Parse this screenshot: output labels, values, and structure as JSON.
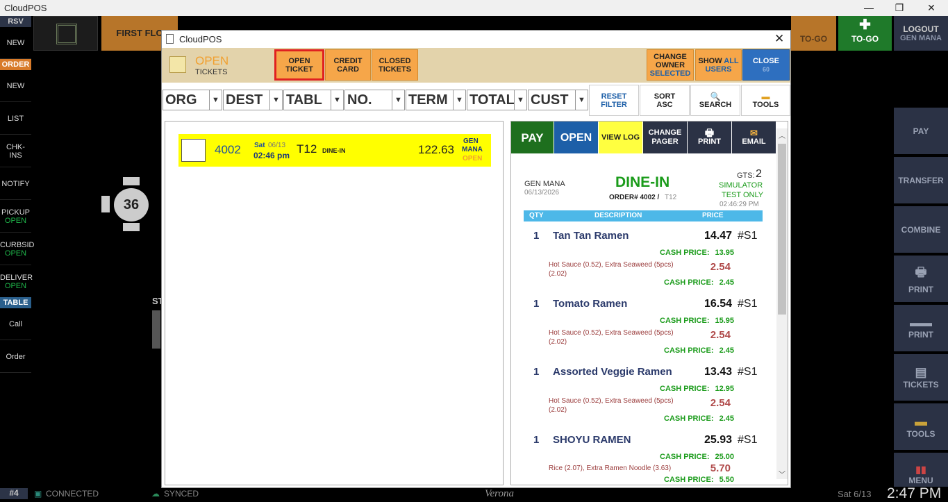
{
  "window": {
    "title": "CloudPOS",
    "min": "—",
    "restore": "❐",
    "close": "✕"
  },
  "leftbar": {
    "rsv": "RSV",
    "new1": "NEW",
    "order": "ORDER",
    "new2": "NEW",
    "list": "LIST",
    "chkins": "CHK-INS",
    "notify": "NOTIFY",
    "pickup": "PICKUP",
    "pickup_status": "OPEN",
    "curbside": "CURBSID",
    "curbside_status": "OPEN",
    "delivery": "DELIVER",
    "delivery_status": "OPEN",
    "table": "TABLE",
    "call": "Call",
    "order2": "Order"
  },
  "topbar": {
    "first_floor": "FIRST FLO",
    "togo1": "TO-GO",
    "togo2": "TO-GO",
    "logout": "LOGOUT",
    "logout_user": "GEN MANA"
  },
  "rightbar": {
    "pay": "PAY",
    "transfer": "TRANSFER",
    "combine": "COMBINE",
    "print1": "PRINT",
    "print2": "PRINT",
    "tickets": "TICKETS",
    "tools": "TOOLS",
    "menu": "MENU"
  },
  "floor": {
    "table_number": "36",
    "partial_label": "ST"
  },
  "statusbar": {
    "station": "#4",
    "connected": "CONNECTED",
    "synced": "SYNCED",
    "brand": "Verona",
    "date": "Sat 6/13",
    "time": "2:47 PM"
  },
  "dialog": {
    "title": "CloudPOS",
    "header": {
      "status_title": "OPEN",
      "status_sub": "TICKETS",
      "open_ticket": [
        "OPEN",
        "TICKET"
      ],
      "credit_card": [
        "CREDIT",
        "CARD"
      ],
      "closed_tickets": [
        "CLOSED",
        "TICKETS"
      ],
      "change_owner": [
        "CHANGE",
        "OWNER",
        "SELECTED"
      ],
      "show_all": [
        "SHOW",
        "ALL",
        "USERS"
      ],
      "close": [
        "CLOSE",
        "60"
      ]
    },
    "filters": [
      {
        "label": "ORG"
      },
      {
        "label": "DEST"
      },
      {
        "label": "TABL"
      },
      {
        "label": "NO."
      },
      {
        "label": "TERM"
      },
      {
        "label": "TOTAL"
      },
      {
        "label": "CUST"
      }
    ],
    "tools": {
      "reset": [
        "RESET",
        "FILTER"
      ],
      "sort": [
        "SORT",
        "ASC"
      ],
      "search": "SEARCH",
      "tools": "TOOLS"
    },
    "ticket": {
      "number": "4002",
      "day": "Sat",
      "date": "06/13",
      "time": "02:46 pm",
      "table": "T12",
      "type": "DINE-IN",
      "total": "122.63",
      "owner1": "GEN",
      "owner2": "MANA",
      "status": "OPEN"
    },
    "actions": {
      "pay": "PAY",
      "open": "OPEN",
      "view_log": "VIEW LOG",
      "change_pager": [
        "CHANGE",
        "PAGER"
      ],
      "print": "PRINT",
      "email": "EMAIL"
    },
    "receipt": {
      "owner": "GEN MANA",
      "date": "06/13/2026",
      "type": "DINE-IN",
      "order_label": "ORDER# 4002 /",
      "order_table": "T12",
      "gts_label": "GTS:",
      "gts": "2",
      "sim1": "SIMULATOR",
      "sim2": "TEST ONLY",
      "time": "02:46:29 PM",
      "col_qty": "QTY",
      "col_desc": "DESCRIPTION",
      "col_price": "PRICE",
      "items": [
        {
          "qty": "1",
          "name": "Tan Tan Ramen",
          "price": "14.47",
          "seat": "#S1",
          "cash_label": "CASH PRICE:",
          "cash": "13.95",
          "mods1": "Hot Sauce (0.52), Extra Seaweed (5pcs)",
          "mods2": "(2.02)",
          "mod_price": "2.54",
          "mod_cash_label": "CASH PRICE:",
          "mod_cash": "2.45"
        },
        {
          "qty": "1",
          "name": "Tomato Ramen",
          "price": "16.54",
          "seat": "#S1",
          "cash_label": "CASH PRICE:",
          "cash": "15.95",
          "mods1": "Hot Sauce (0.52), Extra Seaweed (5pcs)",
          "mods2": "(2.02)",
          "mod_price": "2.54",
          "mod_cash_label": "CASH PRICE:",
          "mod_cash": "2.45"
        },
        {
          "qty": "1",
          "name": "Assorted Veggie Ramen",
          "price": "13.43",
          "seat": "#S1",
          "cash_label": "CASH PRICE:",
          "cash": "12.95",
          "mods1": "Hot Sauce (0.52), Extra Seaweed (5pcs)",
          "mods2": "(2.02)",
          "mod_price": "2.54",
          "mod_cash_label": "CASH PRICE:",
          "mod_cash": "2.45"
        },
        {
          "qty": "1",
          "name": "SHOYU RAMEN",
          "price": "25.93",
          "seat": "#S1",
          "cash_label": "CASH PRICE:",
          "cash": "25.00",
          "mods1": "Rice (2.07), Extra Ramen Noodle (3.63)",
          "mods2": "",
          "mod_price": "5.70",
          "mod_cash_label": "CASH PRICE:",
          "mod_cash": "5.50"
        }
      ]
    }
  },
  "colors": {
    "accent_orange": "#f6a649",
    "pay_green": "#1e7a1e",
    "open_blue": "#1d5fa8",
    "highlight_red": "#e02020",
    "ticket_yellow": "#ffff00"
  }
}
